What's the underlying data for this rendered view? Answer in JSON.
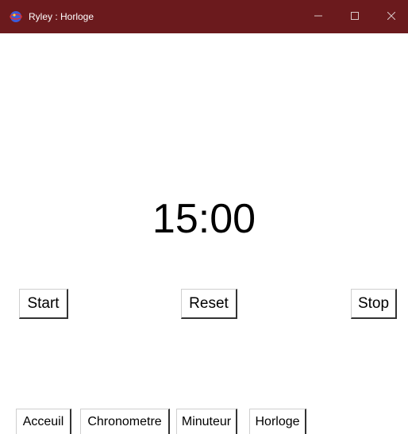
{
  "window": {
    "title": "Ryley : Horloge",
    "app_icon": "app-globe-icon",
    "controls": {
      "minimize_icon": "minimize-icon",
      "maximize_icon": "maximize-icon",
      "close_icon": "close-icon"
    },
    "titlebar_color": "#6b1a1d"
  },
  "timer": {
    "display": "15:00"
  },
  "controls": {
    "start_label": "Start",
    "reset_label": "Reset",
    "stop_label": "Stop"
  },
  "nav": {
    "items": [
      {
        "label": "Acceuil"
      },
      {
        "label": "Chronometre"
      },
      {
        "label": "Minuteur"
      },
      {
        "label": "Horloge"
      }
    ]
  }
}
